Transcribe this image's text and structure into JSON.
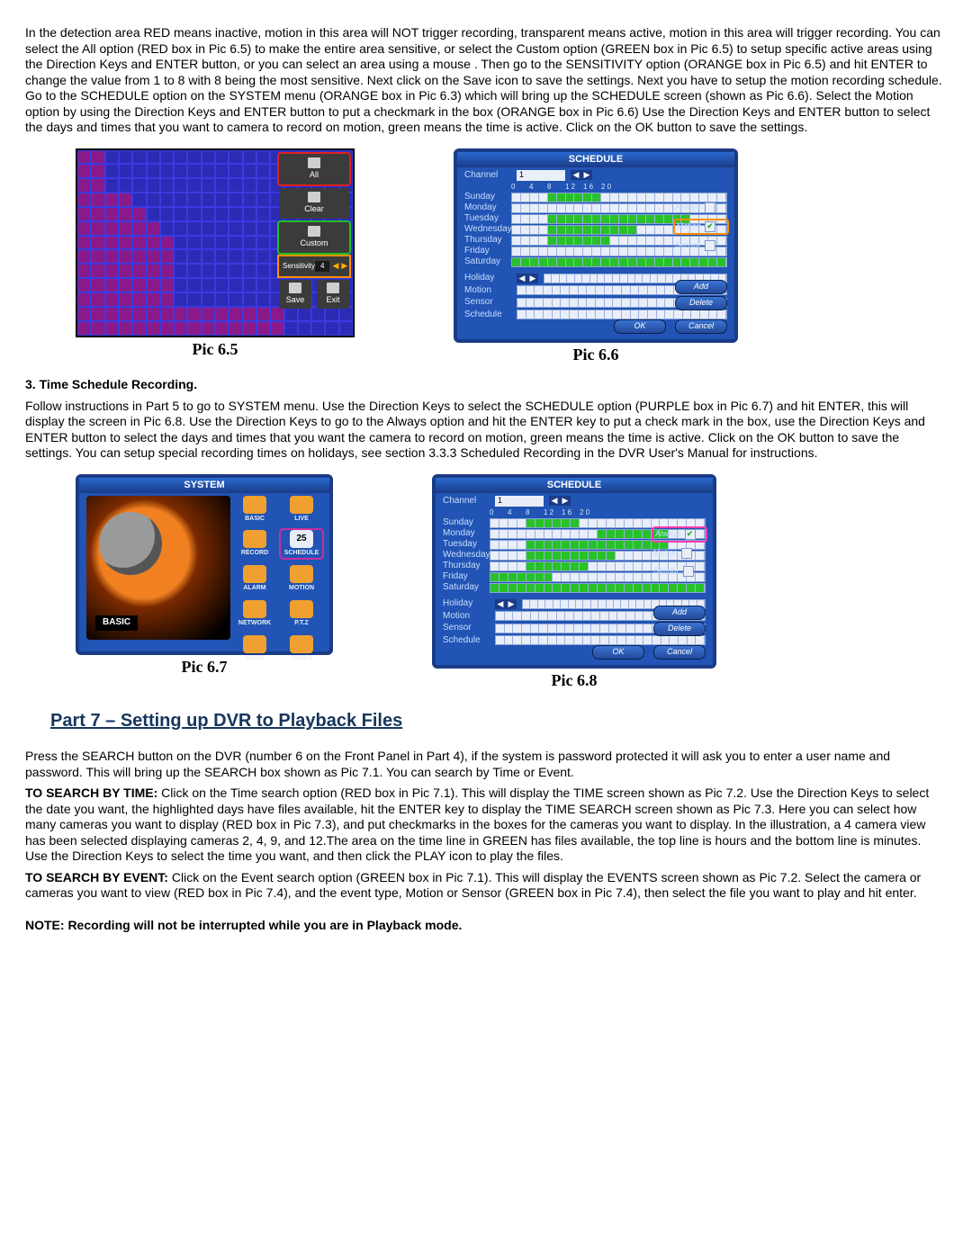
{
  "intro_para": "In the detection area RED means inactive, motion in this area will NOT trigger recording, transparent means active, motion in this area will trigger recording. You can select the All option (RED box in Pic 6.5) to make the entire area sensitive, or select the Custom option (GREEN box in Pic 6.5) to setup specific active areas using the Direction Keys and ENTER button, or you can select an area using a mouse . Then go to the SENSITIVITY option (ORANGE box in Pic 6.5) and hit ENTER to change the value from 1 to 8 with 8 being the most sensitive. Next click on the Save icon to save the settings. Next you have to setup the motion recording schedule. Go to the SCHEDULE option on the SYSTEM menu (ORANGE box in Pic 6.3) which will bring up the SCHEDULE screen (shown as Pic 6.6).  Select the Motion option by using the Direction Keys and ENTER button to put a checkmark in the box (ORANGE box in Pic 6.6) Use the Direction Keys and ENTER button to select the days and times that you want to camera to record on motion, green means the time is active. Click on the OK button to save the settings.",
  "caption_65": "Pic 6.5",
  "caption_66": "Pic 6.6",
  "caption_67": "Pic 6.7",
  "caption_68": "Pic 6.8",
  "sec3_heading": "3. Time Schedule Recording.",
  "sec3_para": "Follow instructions in Part 5 to go to SYSTEM menu. Use the Direction Keys to select the SCHEDULE option (PURPLE box in Pic 6.7) and hit ENTER, this will display the screen in Pic 6.8.  Use the Direction Keys to go to the Always option and hit the ENTER key to put a check mark in the box, use the Direction Keys and ENTER button to select the days and times that you want the camera to record on motion, green means the time is active. Click on the OK button to save the settings. You can setup special recording times on holidays, see section 3.3.3 Scheduled Recording in the DVR User's Manual for instructions.",
  "part7_title": "Part 7 – Setting up DVR to Playback Files",
  "p7_intro": "Press the SEARCH button on the DVR (number 6 on the Front Panel in Part 4), if the system is password protected it will ask you to enter a user name and password. This will bring up the SEARCH box shown as Pic 7.1. You can search by Time or Event.",
  "p7_time_label": " TO SEARCH BY TIME: ",
  "p7_time_text": "Click on the Time search option (RED box in Pic 7.1). This will display the TIME screen shown as Pic 7.2. Use the Direction Keys to select the date you want, the highlighted days have files available, hit the ENTER key to display the TIME SEARCH screen shown as Pic 7.3. Here you can select how many cameras you want to display (RED box in Pic 7.3), and put checkmarks in the boxes for the cameras you want to display. In the illustration, a 4 camera view has been selected displaying cameras 2, 4, 9, and 12.The area on the time line in GREEN has files available, the top line is hours and the bottom line is minutes.  Use the Direction Keys to select the time you want, and then click the PLAY icon to play the files.",
  "p7_event_label": "TO SEARCH BY EVENT: ",
  "p7_event_text": "Click on the Event search option (GREEN box in Pic 7.1). This will display the EVENTS screen shown as Pic 7.2. Select the camera or cameras you want to view (RED box in Pic 7.4), and the event type, Motion or Sensor (GREEN box in Pic 7.4), then select the file you want to play and hit enter.",
  "p7_note": "NOTE: Recording will not be interrupted while you are in Playback mode.",
  "pic65": {
    "btn_all": "All",
    "btn_clear": "Clear",
    "btn_custom": "Custom",
    "sens_label": "Sensitivity",
    "sens_value": "4",
    "btn_save": "Save",
    "btn_exit": "Exit"
  },
  "schedule": {
    "title": "SCHEDULE",
    "channel": "Channel",
    "ch_value": "1",
    "ticks": [
      "0",
      "4",
      "8",
      "1 2",
      "1 6",
      "2 0"
    ],
    "days": [
      "Sunday",
      "Monday",
      "Tuesday",
      "Wednesday",
      "Thursday",
      "Friday",
      "Saturday"
    ],
    "legend_always": "Always",
    "legend_motion": "Motion",
    "legend_sensor": "Sensor",
    "holiday": "Holiday",
    "motion": "Motion",
    "sensor": "Sensor",
    "schedule": "Schedule",
    "btn_add": "Add",
    "btn_delete": "Delete",
    "btn_ok": "OK",
    "btn_cancel": "Cancel",
    "pic66_green": {
      "Sunday": [
        4,
        5,
        6,
        7,
        8,
        9
      ],
      "Tuesday": [
        4,
        5,
        6,
        7,
        8,
        9,
        10,
        11,
        12,
        13,
        14,
        15,
        16,
        17,
        18,
        19
      ],
      "Wednesday": [
        4,
        5,
        6,
        7,
        8,
        9,
        10,
        11,
        12,
        13
      ],
      "Thursday": [
        4,
        5,
        6,
        7,
        8,
        9,
        10
      ],
      "Saturday": [
        0,
        1,
        2,
        3,
        4,
        5,
        6,
        7,
        8,
        9,
        10,
        11,
        12,
        13,
        14,
        15,
        16,
        17,
        18,
        19,
        20,
        21,
        22,
        23
      ]
    },
    "pic68_green": {
      "Sunday": [
        4,
        5,
        6,
        7,
        8,
        9
      ],
      "Monday": [
        12,
        13,
        14,
        15,
        16,
        17,
        18,
        19
      ],
      "Tuesday": [
        4,
        5,
        6,
        7,
        8,
        9,
        10,
        11,
        12,
        13,
        14,
        15,
        16,
        17,
        18,
        19
      ],
      "Wednesday": [
        4,
        5,
        6,
        7,
        8,
        9,
        10,
        11,
        12,
        13
      ],
      "Thursday": [
        4,
        5,
        6,
        7,
        8,
        9,
        10
      ],
      "Friday": [
        0,
        1,
        2,
        3,
        4,
        5,
        6
      ],
      "Saturday": [
        0,
        1,
        2,
        3,
        4,
        5,
        6,
        7,
        8,
        9,
        10,
        11,
        12,
        13,
        14,
        15,
        16,
        17,
        18,
        19,
        20,
        21,
        22,
        23
      ]
    }
  },
  "system": {
    "title": "SYSTEM",
    "basic": "BASIC",
    "items": [
      "BASIC",
      "LIVE",
      "RECORD",
      "SCHEDULE",
      "ALARM",
      "MOTION",
      "NETWORK",
      "P.T.Z",
      "USER",
      "TOOLS"
    ],
    "cal_day": "25"
  }
}
